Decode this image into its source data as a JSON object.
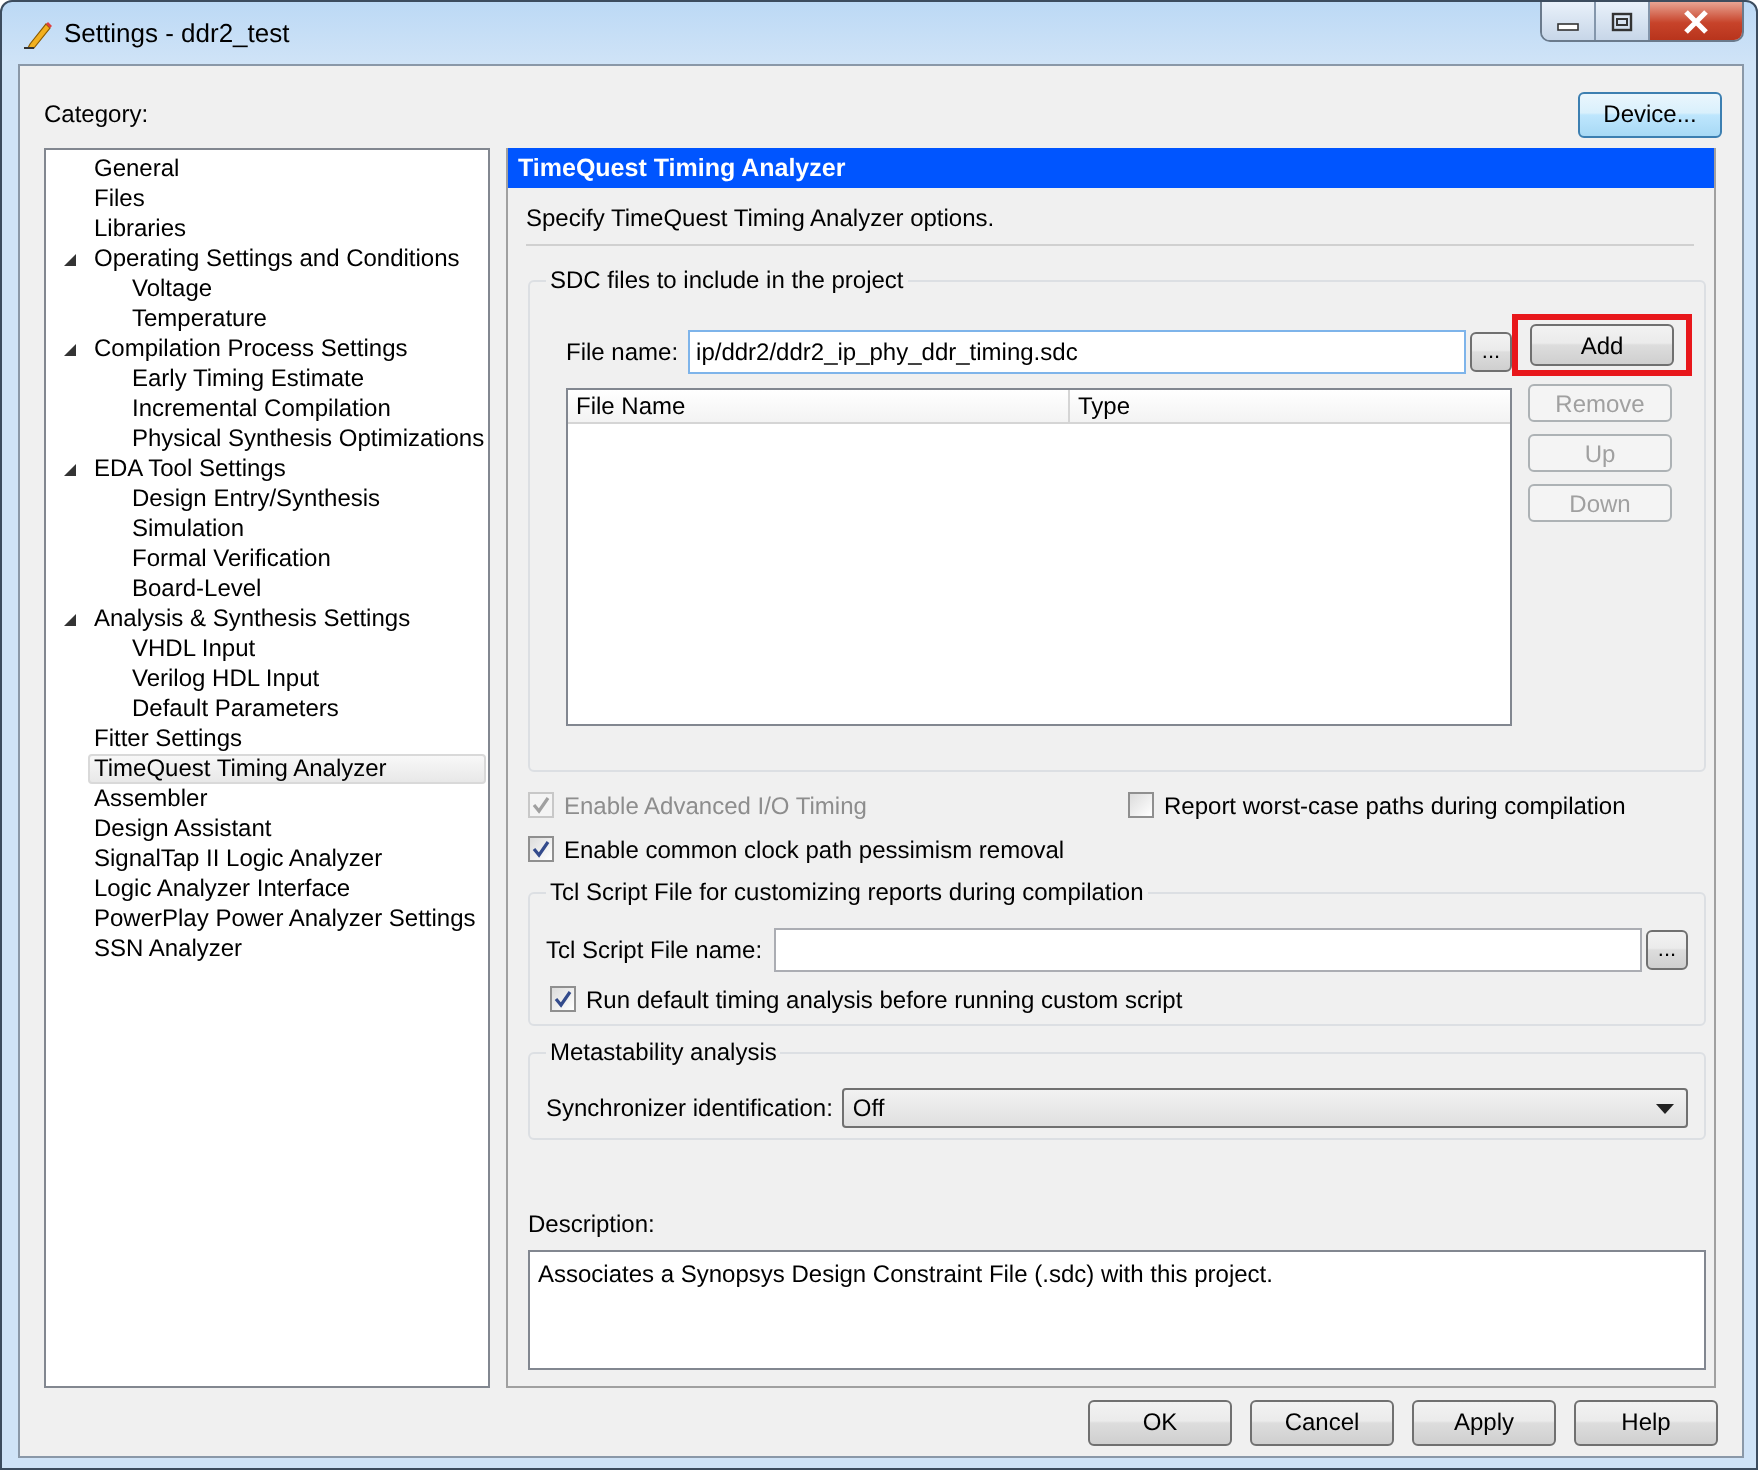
{
  "window": {
    "title": "Settings - ddr2_test"
  },
  "category_label": "Category:",
  "device_button": "Device...",
  "categories": [
    {
      "label": "General",
      "selected": false
    },
    {
      "label": "Files",
      "selected": false
    },
    {
      "label": "Libraries",
      "selected": false
    },
    {
      "label": "Operating Settings and Conditions",
      "selected": false,
      "expanded": true,
      "children": [
        {
          "label": "Voltage",
          "selected": false
        },
        {
          "label": "Temperature",
          "selected": false
        }
      ]
    },
    {
      "label": "Compilation Process Settings",
      "selected": false,
      "expanded": true,
      "children": [
        {
          "label": "Early Timing Estimate",
          "selected": false
        },
        {
          "label": "Incremental Compilation",
          "selected": false
        },
        {
          "label": "Physical Synthesis Optimizations",
          "selected": false
        }
      ]
    },
    {
      "label": "EDA Tool Settings",
      "selected": false,
      "expanded": true,
      "children": [
        {
          "label": "Design Entry/Synthesis",
          "selected": false
        },
        {
          "label": "Simulation",
          "selected": false
        },
        {
          "label": "Formal Verification",
          "selected": false
        },
        {
          "label": "Board-Level",
          "selected": false
        }
      ]
    },
    {
      "label": "Analysis & Synthesis Settings",
      "selected": false,
      "expanded": true,
      "children": [
        {
          "label": "VHDL Input",
          "selected": false
        },
        {
          "label": "Verilog HDL Input",
          "selected": false
        },
        {
          "label": "Default Parameters",
          "selected": false
        }
      ]
    },
    {
      "label": "Fitter Settings",
      "selected": false
    },
    {
      "label": "TimeQuest Timing Analyzer",
      "selected": true
    },
    {
      "label": "Assembler",
      "selected": false
    },
    {
      "label": "Design Assistant",
      "selected": false
    },
    {
      "label": "SignalTap II Logic Analyzer",
      "selected": false
    },
    {
      "label": "Logic Analyzer Interface",
      "selected": false
    },
    {
      "label": "PowerPlay Power Analyzer Settings",
      "selected": false
    },
    {
      "label": "SSN Analyzer",
      "selected": false
    }
  ],
  "panel": {
    "title": "TimeQuest Timing Analyzer",
    "intro": "Specify TimeQuest Timing Analyzer options.",
    "sdc_group": {
      "title": "SDC files to include in the project",
      "file_label": "File name:",
      "file_value": "ip/ddr2/ddr2_ip_phy_ddr_timing.sdc",
      "browse": "...",
      "columns": [
        "File Name",
        "Type"
      ],
      "buttons": [
        {
          "label": "Add",
          "disabled": false,
          "highlighted": true
        },
        {
          "label": "Remove",
          "disabled": true,
          "highlighted": false
        },
        {
          "label": "Up",
          "disabled": true,
          "highlighted": false
        },
        {
          "label": "Down",
          "disabled": true,
          "highlighted": false
        }
      ]
    },
    "options": [
      {
        "label": "Enable Advanced I/O Timing",
        "checked": true,
        "disabled": true
      },
      {
        "label": "Report worst-case paths during compilation",
        "checked": false,
        "disabled": false
      },
      {
        "label": "Enable common clock path pessimism removal",
        "checked": true,
        "disabled": false
      }
    ],
    "tcl_group": {
      "title": "Tcl Script File for customizing reports during compilation",
      "file_label": "Tcl Script File name:",
      "browse": "...",
      "run_default": {
        "label": "Run default timing analysis before running custom script",
        "checked": true
      }
    },
    "meta_group": {
      "title": "Metastability analysis",
      "label": "Synchronizer identification:",
      "value": "Off"
    },
    "description": {
      "label": "Description:",
      "text": "Associates a Synopsys Design Constraint File (.sdc) with this project."
    }
  },
  "buttons": [
    {
      "label": "OK"
    },
    {
      "label": "Cancel"
    },
    {
      "label": "Apply"
    },
    {
      "label": "Help"
    }
  ]
}
